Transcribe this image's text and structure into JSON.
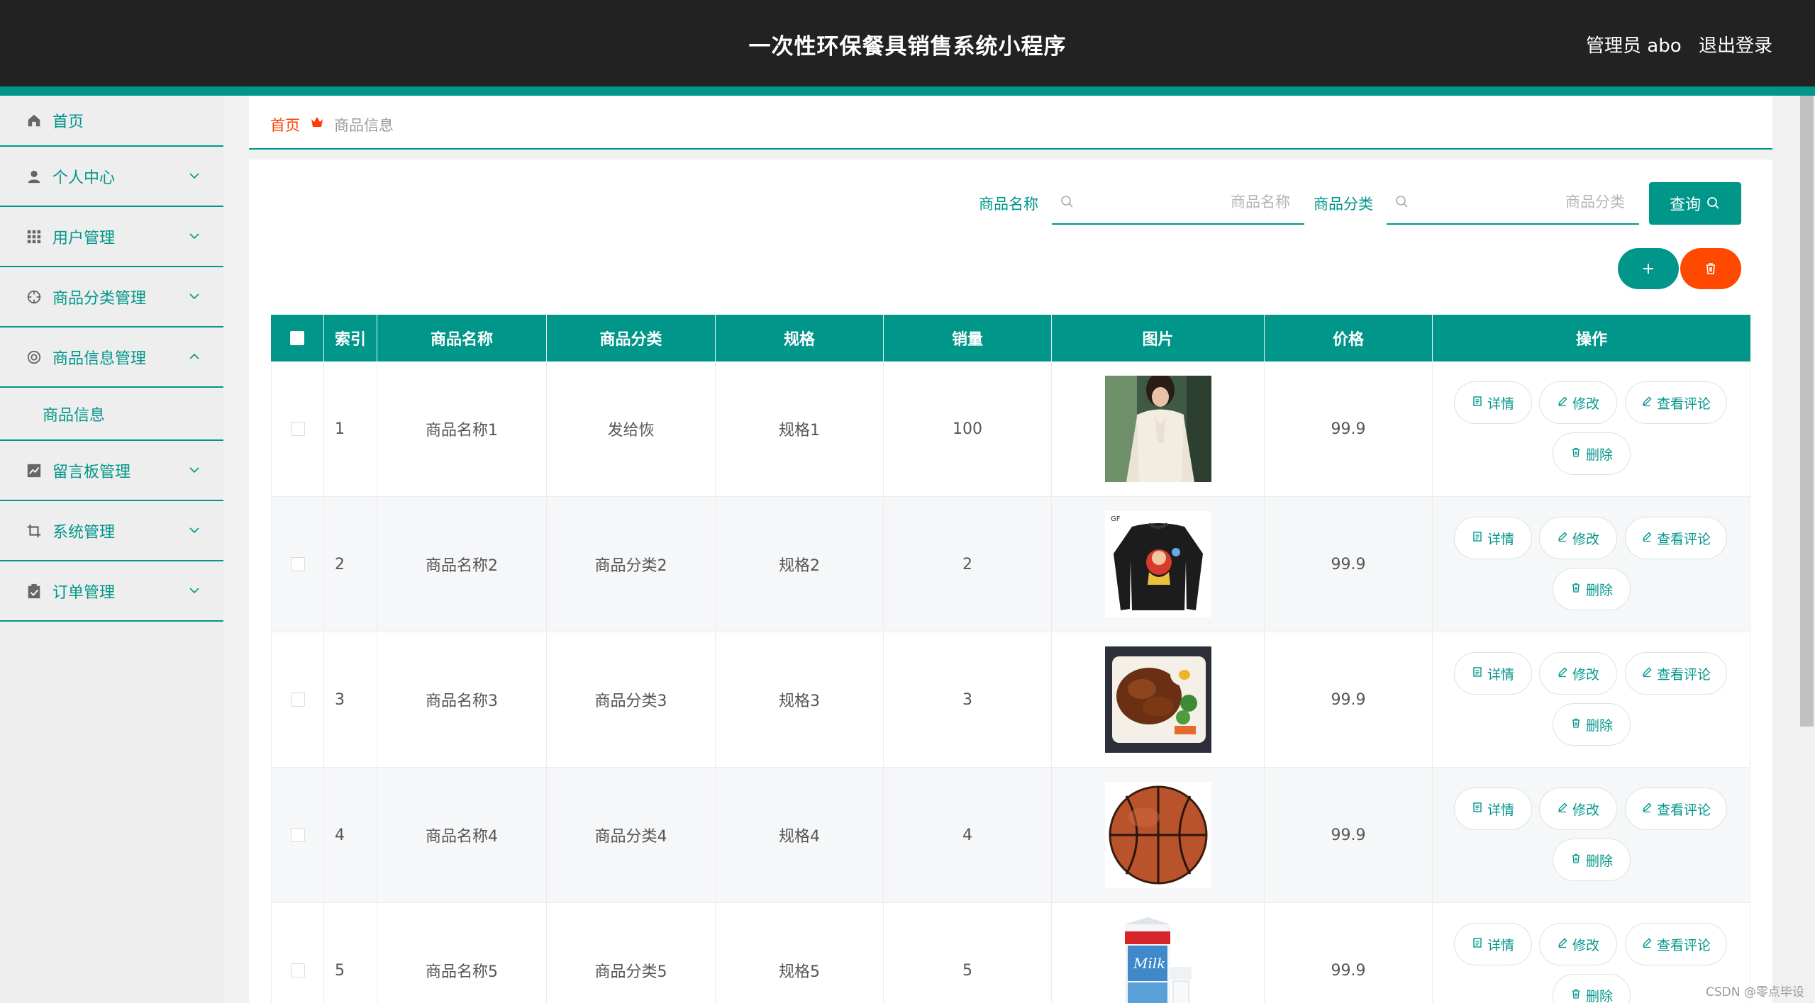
{
  "header": {
    "title": "一次性环保餐具销售系统小程序",
    "admin": "管理员 abo",
    "logout": "退出登录"
  },
  "sidebar": {
    "items": [
      {
        "label": "首页",
        "icon": "home-icon"
      },
      {
        "label": "个人中心",
        "icon": "user-icon"
      },
      {
        "label": "用户管理",
        "icon": "grid-icon"
      },
      {
        "label": "商品分类管理",
        "icon": "target-icon"
      },
      {
        "label": "商品信息管理",
        "icon": "lifebuoy-icon",
        "expanded": true
      },
      {
        "label": "商品信息",
        "submenu": true
      },
      {
        "label": "留言板管理",
        "icon": "chart-icon"
      },
      {
        "label": "系统管理",
        "icon": "crop-icon"
      },
      {
        "label": "订单管理",
        "icon": "clipboard-icon"
      }
    ]
  },
  "breadcrumb": {
    "home": "首页",
    "current": "商品信息"
  },
  "search": {
    "name_label": "商品名称",
    "name_placeholder": "商品名称",
    "category_label": "商品分类",
    "category_placeholder": "商品分类",
    "query_label": "查询"
  },
  "table": {
    "headers": [
      "索引",
      "商品名称",
      "商品分类",
      "规格",
      "销量",
      "图片",
      "价格",
      "操作"
    ],
    "rows": [
      {
        "index": "1",
        "name": "商品名称1",
        "category": "发给恢",
        "spec": "规格1",
        "sales": "100",
        "image": "blouse-photo",
        "price": "99.9"
      },
      {
        "index": "2",
        "name": "商品名称2",
        "category": "商品分类2",
        "spec": "规格2",
        "sales": "2",
        "image": "sweatshirt-photo",
        "price": "99.9"
      },
      {
        "index": "3",
        "name": "商品名称3",
        "category": "商品分类3",
        "spec": "规格3",
        "sales": "3",
        "image": "bento-photo",
        "price": "99.9"
      },
      {
        "index": "4",
        "name": "商品名称4",
        "category": "商品分类4",
        "spec": "规格4",
        "sales": "4",
        "image": "basketball-photo",
        "price": "99.9"
      },
      {
        "index": "5",
        "name": "商品名称5",
        "category": "商品分类5",
        "spec": "规格5",
        "sales": "5",
        "image": "milk-photo",
        "price": "99.9"
      }
    ],
    "actions": {
      "detail": "详情",
      "edit": "修改",
      "review": "查看评论",
      "delete": "删除"
    }
  },
  "colors": {
    "primary": "#00968a",
    "danger": "#ff4800",
    "header_bg": "#222222",
    "breadcrumb_home": "#ff3d00"
  },
  "watermark": "CSDN @零点毕设"
}
